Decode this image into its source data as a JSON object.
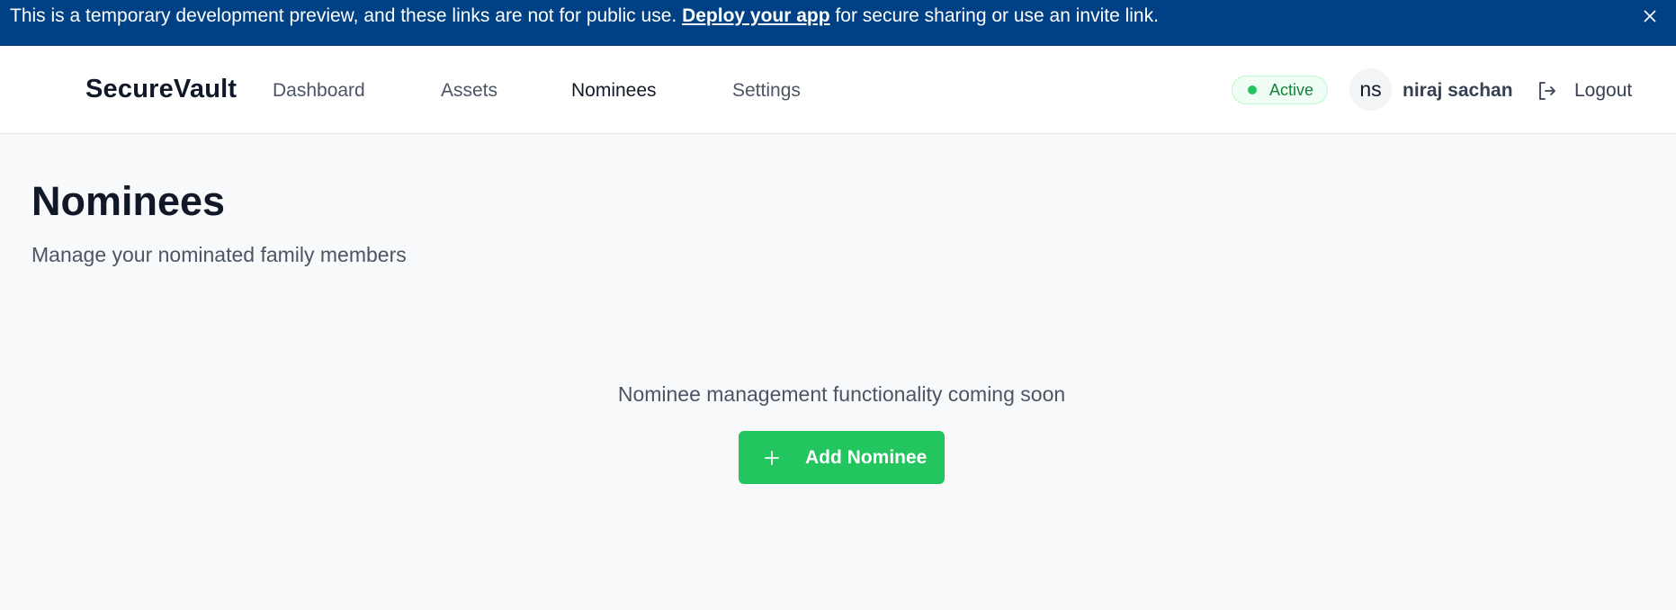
{
  "banner": {
    "text_before": "This is a temporary development preview, and these links are not for public use. ",
    "link_text": "Deploy your app",
    "text_after": " for secure sharing or use an invite link.",
    "background": "#004185"
  },
  "header": {
    "brand": "SecureVault",
    "nav": [
      {
        "label": "Dashboard",
        "active": false
      },
      {
        "label": "Assets",
        "active": false
      },
      {
        "label": "Nominees",
        "active": true
      },
      {
        "label": "Settings",
        "active": false
      }
    ],
    "status": {
      "label": "Active",
      "color": "#22c55e"
    },
    "user": {
      "initials": "ns",
      "name": "niraj sachan"
    },
    "logout_label": "Logout"
  },
  "main": {
    "title": "Nominees",
    "subtitle": "Manage your nominated family members",
    "empty_message": "Nominee management functionality coming soon",
    "add_button_label": "Add Nominee",
    "accent": "#22c55e"
  },
  "icons": {
    "banner_close": "close-icon",
    "logout": "logout-icon",
    "add": "plus-icon"
  }
}
